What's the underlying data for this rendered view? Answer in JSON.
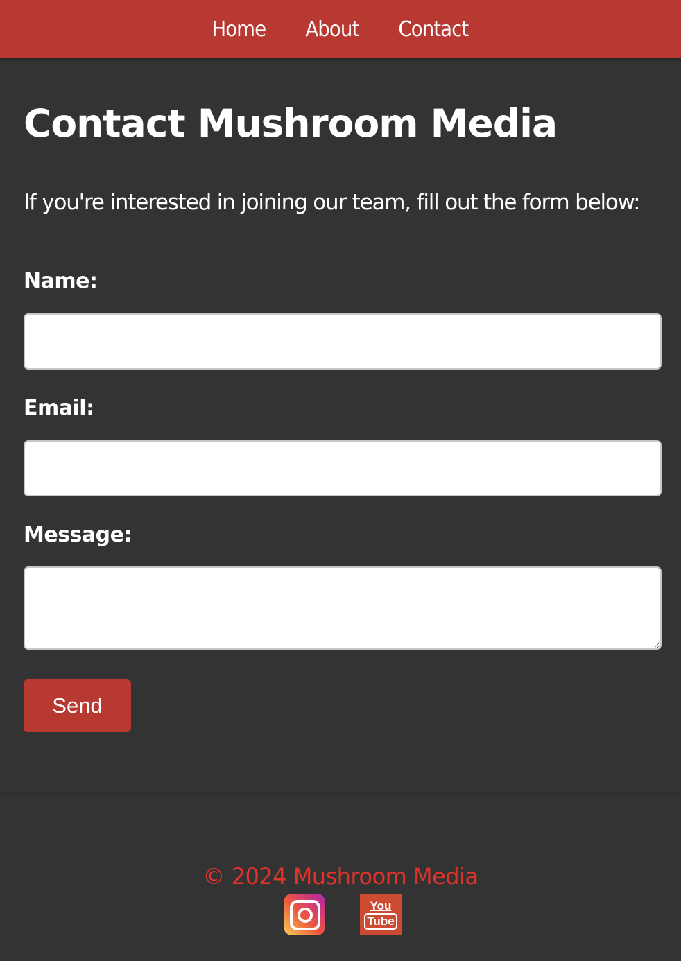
{
  "nav": {
    "items": [
      {
        "label": "Home"
      },
      {
        "label": "About"
      },
      {
        "label": "Contact"
      }
    ]
  },
  "page": {
    "title": "Contact Mushroom Media",
    "intro": "If you're interested in joining our team, fill out the form below:"
  },
  "form": {
    "name_label": "Name:",
    "name_value": "",
    "email_label": "Email:",
    "email_value": "",
    "message_label": "Message:",
    "message_value": "",
    "send_label": "Send"
  },
  "footer": {
    "copyright": "© 2024 Mushroom Media",
    "social": [
      {
        "icon": "instagram-icon"
      },
      {
        "icon": "youtube-icon",
        "text_top": "You",
        "text_bottom": "Tube"
      }
    ]
  },
  "colors": {
    "accent": "#b83832",
    "background": "#333333",
    "footer_text": "#e2332a"
  }
}
